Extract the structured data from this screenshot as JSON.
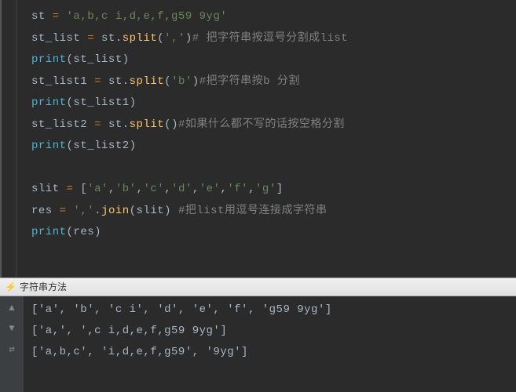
{
  "editor": {
    "lines": [
      [
        {
          "cls": "kw-var",
          "t": "st "
        },
        {
          "cls": "op",
          "t": "= "
        },
        {
          "cls": "str",
          "t": "'a,b,c i,d,e,f,g59 9yg'"
        }
      ],
      [
        {
          "cls": "kw-var",
          "t": "st_list "
        },
        {
          "cls": "op",
          "t": "= "
        },
        {
          "cls": "kw-var",
          "t": "st."
        },
        {
          "cls": "method",
          "t": "split"
        },
        {
          "cls": "kw-var",
          "t": "("
        },
        {
          "cls": "str",
          "t": "','"
        },
        {
          "cls": "kw-var",
          "t": ")"
        },
        {
          "cls": "comment",
          "t": "# 把字符串按逗号分割成list"
        }
      ],
      [
        {
          "cls": "func",
          "t": "print"
        },
        {
          "cls": "kw-var",
          "t": "(st_list)"
        }
      ],
      [
        {
          "cls": "kw-var",
          "t": "st_list1 "
        },
        {
          "cls": "op",
          "t": "= "
        },
        {
          "cls": "kw-var",
          "t": "st."
        },
        {
          "cls": "method",
          "t": "split"
        },
        {
          "cls": "kw-var",
          "t": "("
        },
        {
          "cls": "str",
          "t": "'b'"
        },
        {
          "cls": "kw-var",
          "t": ")"
        },
        {
          "cls": "comment",
          "t": "#把字符串按b 分割"
        }
      ],
      [
        {
          "cls": "func",
          "t": "print"
        },
        {
          "cls": "kw-var",
          "t": "(st_list1)"
        }
      ],
      [
        {
          "cls": "kw-var",
          "t": "st_list2 "
        },
        {
          "cls": "op",
          "t": "= "
        },
        {
          "cls": "kw-var",
          "t": "st."
        },
        {
          "cls": "method",
          "t": "split"
        },
        {
          "cls": "kw-var",
          "t": "()"
        },
        {
          "cls": "comment",
          "t": "#如果什么都不写的话按空格分割"
        }
      ],
      [
        {
          "cls": "func",
          "t": "print"
        },
        {
          "cls": "kw-var",
          "t": "(st_list2)"
        }
      ],
      [
        {
          "cls": "kw-var",
          "t": ""
        }
      ],
      [
        {
          "cls": "kw-var",
          "t": "slit "
        },
        {
          "cls": "op",
          "t": "= "
        },
        {
          "cls": "kw-var",
          "t": "["
        },
        {
          "cls": "str",
          "t": "'a'"
        },
        {
          "cls": "kw-var",
          "t": ","
        },
        {
          "cls": "str",
          "t": "'b'"
        },
        {
          "cls": "kw-var",
          "t": ","
        },
        {
          "cls": "str",
          "t": "'c'"
        },
        {
          "cls": "kw-var",
          "t": ","
        },
        {
          "cls": "str",
          "t": "'d'"
        },
        {
          "cls": "kw-var",
          "t": ","
        },
        {
          "cls": "str",
          "t": "'e'"
        },
        {
          "cls": "kw-var",
          "t": ","
        },
        {
          "cls": "str",
          "t": "'f'"
        },
        {
          "cls": "kw-var",
          "t": ","
        },
        {
          "cls": "str",
          "t": "'g'"
        },
        {
          "cls": "kw-var",
          "t": "]"
        }
      ],
      [
        {
          "cls": "kw-var",
          "t": "res "
        },
        {
          "cls": "op",
          "t": "= "
        },
        {
          "cls": "str",
          "t": "','"
        },
        {
          "cls": "kw-var",
          "t": "."
        },
        {
          "cls": "method",
          "t": "join"
        },
        {
          "cls": "kw-var",
          "t": "(slit) "
        },
        {
          "cls": "comment",
          "t": "#把list用逗号连接成字符串"
        }
      ],
      [
        {
          "cls": "func",
          "t": "print"
        },
        {
          "cls": "kw-var",
          "t": "(res)"
        }
      ]
    ]
  },
  "tab": {
    "label": "字符串方法"
  },
  "output": {
    "lines": [
      "['a', 'b', 'c i', 'd', 'e', 'f', 'g59 9yg']",
      "['a,', ',c i,d,e,f,g59 9yg']",
      "['a,b,c', 'i,d,e,f,g59', '9yg']"
    ]
  },
  "gutter_icons": [
    "▲",
    "▼",
    "⇄"
  ]
}
